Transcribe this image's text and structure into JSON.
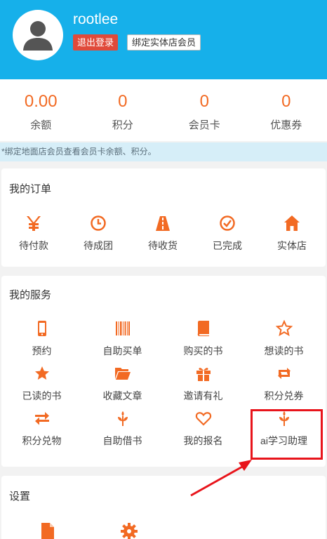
{
  "user": {
    "name": "rootlee",
    "logout_label": "退出登录",
    "bind_label": "绑定实体店会员"
  },
  "stats": [
    {
      "value": "0.00",
      "label": "余额"
    },
    {
      "value": "0",
      "label": "积分"
    },
    {
      "value": "0",
      "label": "会员卡"
    },
    {
      "value": "0",
      "label": "优惠券"
    }
  ],
  "tip": "*绑定地面店会员查看会员卡余额、积分。",
  "orders": {
    "title": "我的订单",
    "items": [
      {
        "label": "待付款",
        "icon": "yen-icon"
      },
      {
        "label": "待成团",
        "icon": "clock-icon"
      },
      {
        "label": "待收货",
        "icon": "road-icon"
      },
      {
        "label": "已完成",
        "icon": "check-circle-icon"
      },
      {
        "label": "实体店",
        "icon": "home-icon"
      }
    ]
  },
  "services": {
    "title": "我的服务",
    "items": [
      {
        "label": "预约",
        "icon": "phone-icon"
      },
      {
        "label": "自助买单",
        "icon": "barcode-icon"
      },
      {
        "label": "购买的书",
        "icon": "book-icon"
      },
      {
        "label": "想读的书",
        "icon": "star-outline-icon"
      },
      {
        "label": "已读的书",
        "icon": "star-filled-icon"
      },
      {
        "label": "收藏文章",
        "icon": "folder-open-icon"
      },
      {
        "label": "邀请有礼",
        "icon": "gift-icon"
      },
      {
        "label": "积分兑券",
        "icon": "retweet-icon"
      },
      {
        "label": "积分兑物",
        "icon": "exchange-icon"
      },
      {
        "label": "自助借书",
        "icon": "leaf-icon"
      },
      {
        "label": "我的报名",
        "icon": "heart-outline-icon"
      },
      {
        "label": "ai学习助理",
        "icon": "leaf-icon"
      }
    ]
  },
  "settings": {
    "title": "设置",
    "items": [
      {
        "icon": "document-icon"
      },
      {
        "icon": "gear-icon"
      }
    ]
  },
  "colors": {
    "header": "#16b0ea",
    "accent": "#f26a23",
    "logout": "#e04a3a",
    "highlight": "#e8141b"
  }
}
